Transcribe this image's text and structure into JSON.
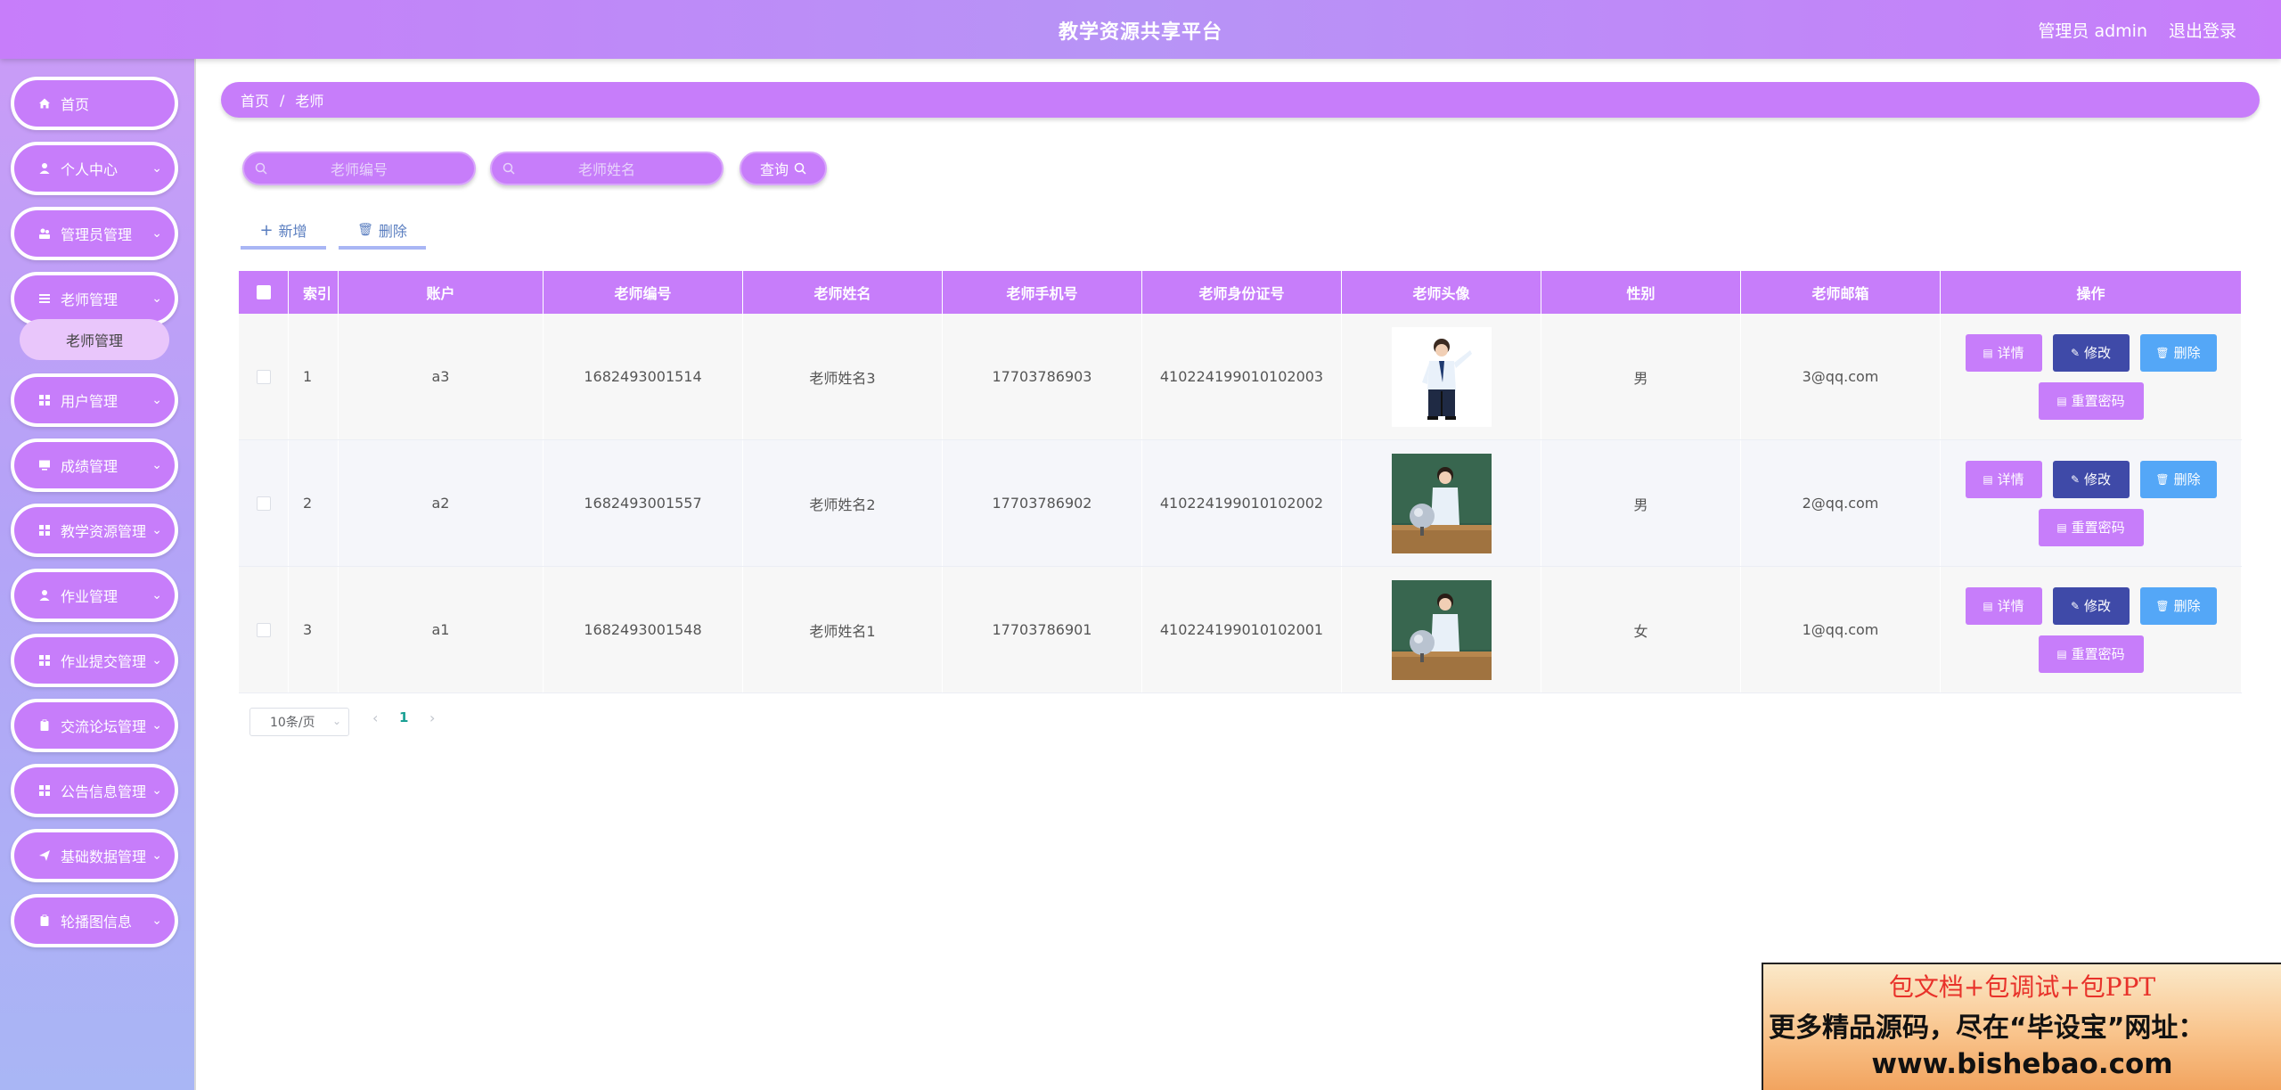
{
  "header": {
    "title": "教学资源共享平台",
    "user": "管理员 admin",
    "logout": "退出登录"
  },
  "sidebar": {
    "items": [
      {
        "label": "首页",
        "icon": "home-icon",
        "has_children": false
      },
      {
        "label": "个人中心",
        "icon": "user-icon",
        "has_children": true
      },
      {
        "label": "管理员管理",
        "icon": "user-group-icon",
        "has_children": true
      },
      {
        "label": "老师管理",
        "icon": "list-icon",
        "has_children": true
      },
      {
        "label": "用户管理",
        "icon": "grid-icon",
        "has_children": true
      },
      {
        "label": "成绩管理",
        "icon": "monitor-icon",
        "has_children": true
      },
      {
        "label": "教学资源管理",
        "icon": "grid-icon",
        "has_children": true
      },
      {
        "label": "作业管理",
        "icon": "user-icon",
        "has_children": true
      },
      {
        "label": "作业提交管理",
        "icon": "grid-icon",
        "has_children": true
      },
      {
        "label": "交流论坛管理",
        "icon": "clipboard-icon",
        "has_children": true
      },
      {
        "label": "公告信息管理",
        "icon": "grid-icon",
        "has_children": true
      },
      {
        "label": "基础数据管理",
        "icon": "send-icon",
        "has_children": true
      },
      {
        "label": "轮播图信息",
        "icon": "clipboard-icon",
        "has_children": true
      }
    ],
    "submenu": {
      "label": "老师管理"
    }
  },
  "breadcrumb": {
    "home": "首页",
    "sep": "/",
    "current": "老师"
  },
  "search": {
    "teacher_no_placeholder": "老师编号",
    "teacher_name_placeholder": "老师姓名",
    "query_label": "查询"
  },
  "actions": {
    "add_label": "新增",
    "delete_label": "删除"
  },
  "table": {
    "headers": [
      "索引",
      "账户",
      "老师编号",
      "老师姓名",
      "老师手机号",
      "老师身份证号",
      "老师头像",
      "性别",
      "老师邮箱",
      "操作"
    ],
    "rows": [
      {
        "index": "1",
        "account": "a3",
        "no": "1682493001514",
        "name": "老师姓名3",
        "phone": "17703786903",
        "id_card": "410224199010102003",
        "avatar": "teacher-standing",
        "gender": "男",
        "email": "3@qq.com"
      },
      {
        "index": "2",
        "account": "a2",
        "no": "1682493001557",
        "name": "老师姓名2",
        "phone": "17703786902",
        "id_card": "410224199010102002",
        "avatar": "teacher-blackboard",
        "gender": "男",
        "email": "2@qq.com"
      },
      {
        "index": "3",
        "account": "a1",
        "no": "1682493001548",
        "name": "老师姓名1",
        "phone": "17703786901",
        "id_card": "410224199010102001",
        "avatar": "teacher-blackboard",
        "gender": "女",
        "email": "1@qq.com"
      }
    ],
    "row_buttons": {
      "detail": "详情",
      "edit": "修改",
      "delete": "删除",
      "reset": "重置密码"
    }
  },
  "pagination": {
    "page_size": "10条/页",
    "current_page": "1"
  },
  "ad": {
    "line1": "包文档+包调试+包PPT",
    "line2": "更多精品源码，尽在“毕设宝”网址：",
    "line3": "www.bishebao.com"
  },
  "colors": {
    "primary": "#c77dfa",
    "edit": "#3f4aa8",
    "delete": "#54a7f7",
    "sidebar_bottom": "#a9b6f5"
  }
}
